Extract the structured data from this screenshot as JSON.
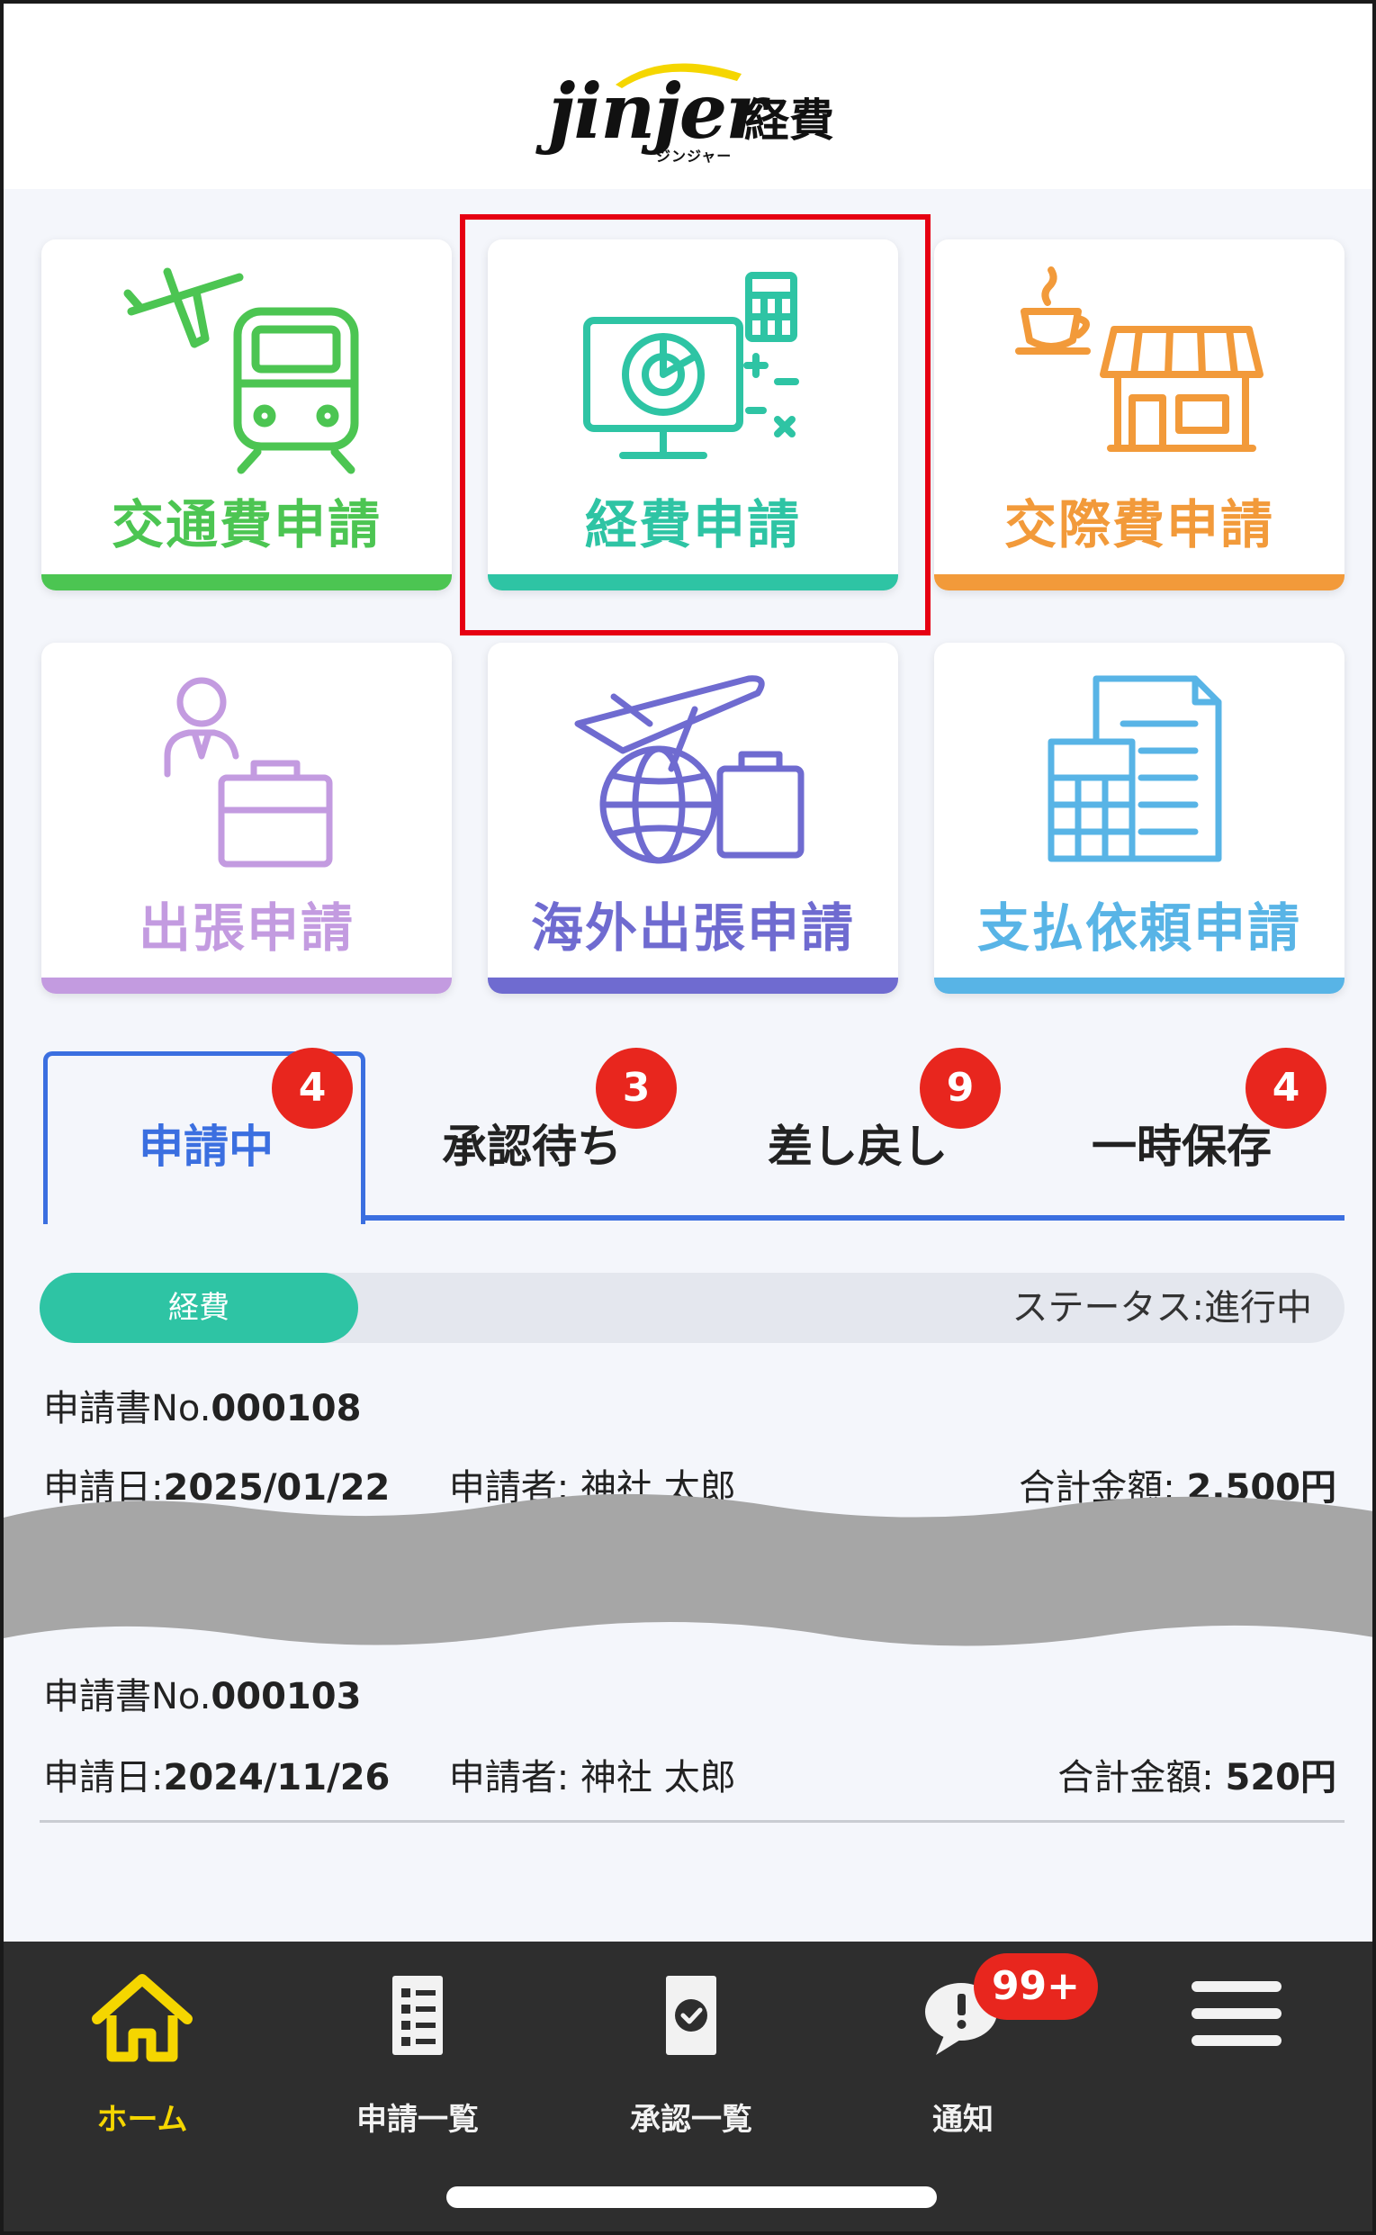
{
  "header": {
    "logo_word": "jinjer",
    "logo_kanji": "経費",
    "logo_sub": "ジンジャー"
  },
  "tiles": [
    {
      "label": "交通費申請",
      "color": "#4cc552",
      "icon": "plane-train-icon"
    },
    {
      "label": "経費申請",
      "color": "#2ec4a4",
      "icon": "monitor-chart-calculator-icon"
    },
    {
      "label": "交際費申請",
      "color": "#f29a3a",
      "icon": "coffee-shop-icon"
    },
    {
      "label": "出張申請",
      "color": "#c39be0",
      "icon": "person-briefcase-icon"
    },
    {
      "label": "海外出張申請",
      "color": "#6f6bd0",
      "icon": "plane-globe-suitcase-icon"
    },
    {
      "label": "支払依頼申請",
      "color": "#58b4e6",
      "icon": "document-calculator-icon"
    }
  ],
  "tabs": [
    {
      "label": "申請中",
      "count": "4"
    },
    {
      "label": "承認待ち",
      "count": "3"
    },
    {
      "label": "差し戻し",
      "count": "9"
    },
    {
      "label": "一時保存",
      "count": "4"
    }
  ],
  "records": [
    {
      "type": "経費",
      "status": "ステータス:進行中",
      "number_label": "申請書No.",
      "number": "000108",
      "date_label": "申請日:",
      "date": "2025/01/22",
      "applicant_label": "申請者:",
      "applicant": "神社 太郎",
      "total_label": "合計金額:",
      "total": "2,500円"
    },
    {
      "number_label": "申請書No.",
      "number": "000103",
      "date_label": "申請日:",
      "date": "2024/11/26",
      "applicant_label": "申請者:",
      "applicant": "神社 太郎",
      "total_label": "合計金額:",
      "total": "520円"
    }
  ],
  "nav": {
    "items": [
      {
        "label": "ホーム",
        "icon": "home-icon"
      },
      {
        "label": "申請一覧",
        "icon": "list-document-icon"
      },
      {
        "label": "承認一覧",
        "icon": "approval-document-icon"
      },
      {
        "label": "通知",
        "icon": "notification-bubble-icon"
      },
      {
        "label": "",
        "icon": "hamburger-menu-icon"
      }
    ],
    "notification_badge": "99+"
  },
  "colors": {
    "accent_blue": "#3b6fe0",
    "badge_red": "#e8261e",
    "nav_active": "#f5d600",
    "highlight_red": "#e60012"
  }
}
